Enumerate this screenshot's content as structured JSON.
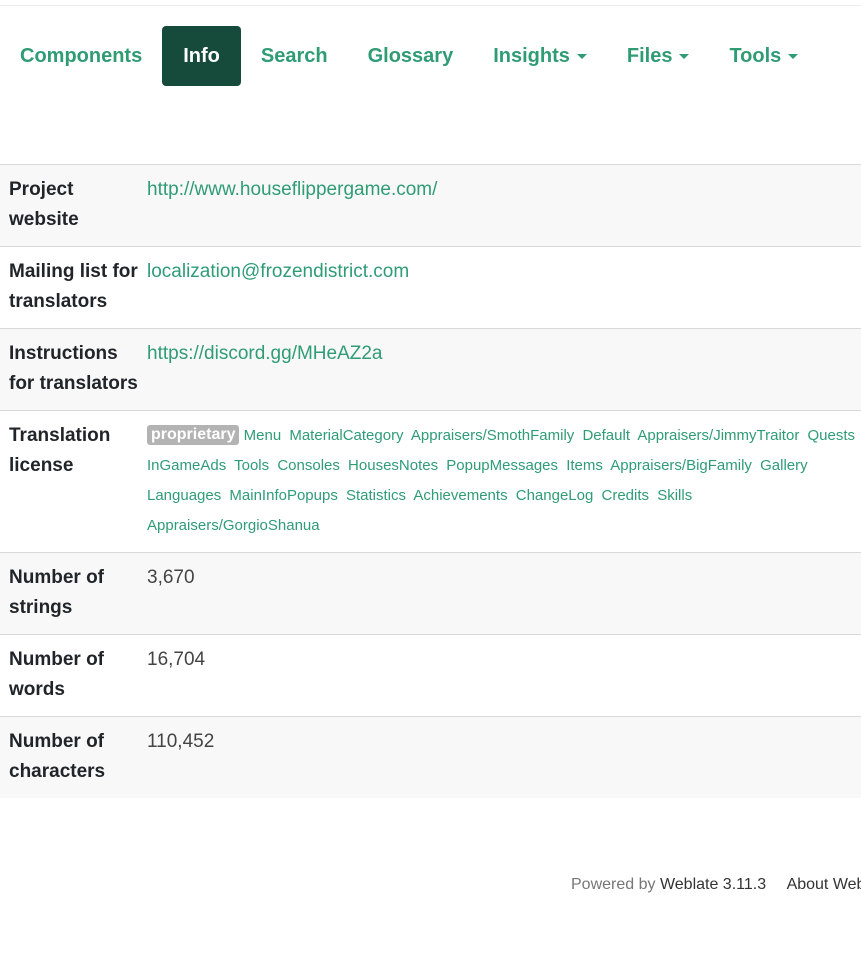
{
  "tabs": [
    {
      "label": "Components",
      "active": false,
      "dropdown": false
    },
    {
      "label": "Info",
      "active": true,
      "dropdown": false
    },
    {
      "label": "Search",
      "active": false,
      "dropdown": false
    },
    {
      "label": "Glossary",
      "active": false,
      "dropdown": false
    },
    {
      "label": "Insights",
      "active": false,
      "dropdown": true
    },
    {
      "label": "Files",
      "active": false,
      "dropdown": true
    },
    {
      "label": "Tools",
      "active": false,
      "dropdown": true
    }
  ],
  "info": {
    "website_label": "Project website",
    "website_value": "http://www.houseflippergame.com/",
    "mailing_label": "Mailing list for translators",
    "mailing_value": "localization@frozendistrict.com",
    "instructions_label": "Instructions for translators",
    "instructions_value": "https://discord.gg/MHeAZ2a",
    "license_label": "Translation license",
    "license_badge": "proprietary",
    "license_components": [
      "Menu",
      "MaterialCategory",
      "Appraisers/SmothFamily",
      "Default",
      "Appraisers/JimmyTraitor",
      "Quests",
      "InGameAds",
      "Tools",
      "Consoles",
      "HousesNotes",
      "PopupMessages",
      "Items",
      "Appraisers/BigFamily",
      "Gallery",
      "Languages",
      "MainInfoPopups",
      "Statistics",
      "Achievements",
      "ChangeLog",
      "Credits",
      "Skills",
      "Appraisers/GorgioShanua"
    ],
    "strings_label": "Number of strings",
    "strings_value": "3,670",
    "words_label": "Number of words",
    "words_value": "16,704",
    "chars_label": "Number of characters",
    "chars_value": "110,452"
  },
  "footer": {
    "powered_by": "Powered by",
    "weblate": "Weblate 3.11.3",
    "about": "About Weblate"
  },
  "colors": {
    "accent": "#2f9c74",
    "active_tab_bg": "#164b3c"
  }
}
